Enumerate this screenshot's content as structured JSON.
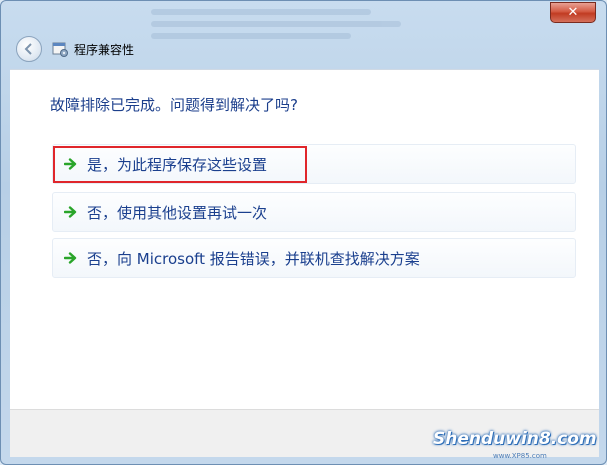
{
  "window": {
    "close_label": "✕",
    "nav_title": "程序兼容性"
  },
  "main": {
    "heading": "故障排除已完成。问题得到解决了吗?",
    "options": [
      {
        "label": "是，为此程序保存这些设置",
        "highlighted": true
      },
      {
        "label": "否，使用其他设置再试一次"
      },
      {
        "label": "否，向 Microsoft 报告错误，并联机查找解决方案"
      }
    ]
  },
  "watermark": {
    "text": "Shenduwin8.com",
    "sub": "www.XP85.com"
  },
  "colors": {
    "accent_text": "#1a3f8e",
    "arrow_green": "#2aa52a",
    "highlight_red": "#e0262b"
  },
  "icons": {
    "back": "back-arrow-icon",
    "nav": "program-compatibility-icon",
    "option": "green-arrow-icon"
  }
}
